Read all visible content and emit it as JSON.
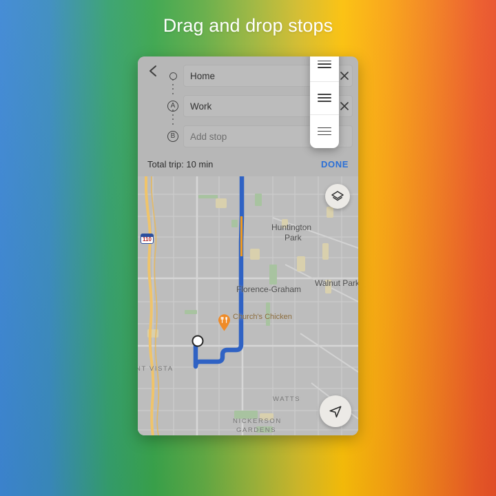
{
  "page": {
    "title": "Drag and drop stops",
    "background_gradient": [
      "#3d87d4",
      "#3aa54c",
      "#fbc009",
      "#e84f28"
    ]
  },
  "directions_panel": {
    "back_icon": "back-chevron-icon",
    "stops": [
      {
        "marker": "○",
        "marker_name": "origin-circle-icon",
        "value": "Home",
        "is_placeholder": false,
        "clear_icon": "✕"
      },
      {
        "marker": "A",
        "marker_name": "waypoint-a-badge",
        "value": "Work",
        "is_placeholder": false,
        "clear_icon": "✕"
      },
      {
        "marker": "B",
        "marker_name": "waypoint-b-badge",
        "value": "Add stop",
        "is_placeholder": true,
        "clear_icon": ""
      }
    ],
    "drag_handles": [
      {
        "label": "drag-handle-1"
      },
      {
        "label": "drag-handle-2"
      },
      {
        "label": "drag-handle-3"
      }
    ],
    "footer": {
      "total_trip": "Total trip: 10 min",
      "done_label": "DONE",
      "done_color": "#2a6fd6"
    }
  },
  "map": {
    "route_color": "#2f62c4",
    "traffic_color": "#f09a1f",
    "labels": {
      "huntington_park_line1": "Huntington",
      "huntington_park_line2": "Park",
      "walnut_park": "Walnut Park",
      "florence_graham": "Florence-Graham",
      "mount_vista": "NT VISTA",
      "watts": "WATTS",
      "nickerson_line1": "NICKERSON",
      "nickerson_line2": "GARDENS"
    },
    "highway_shield": {
      "number": "110",
      "type": "Interstate"
    },
    "poi": {
      "name": "Church's Chicken",
      "icon": "restaurant-pin-icon"
    },
    "controls": {
      "layers": "map-layers-icon",
      "locate": "my-location-icon"
    }
  }
}
